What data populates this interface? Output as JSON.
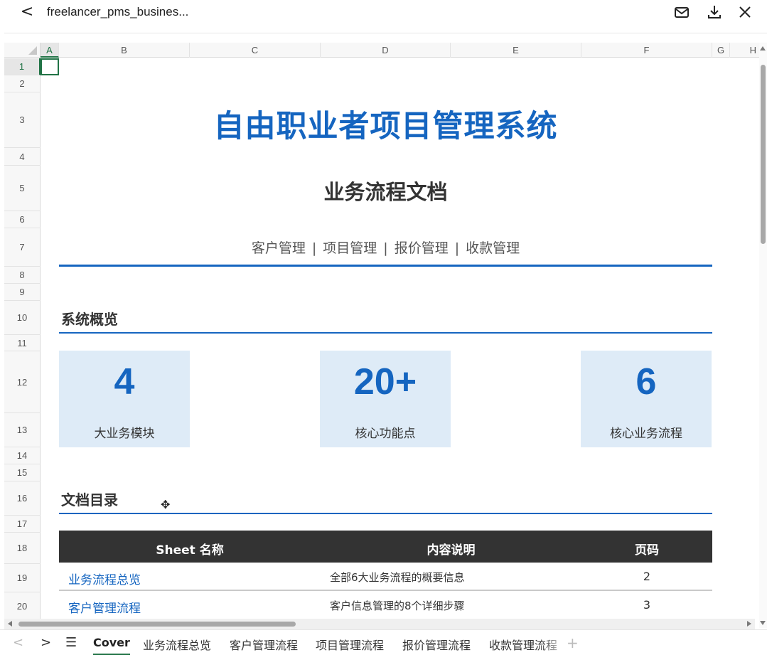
{
  "app": {
    "file_title": "freelancer_pms_busines...",
    "back_glyph": "<",
    "actions": [
      {
        "name": "mail-icon"
      },
      {
        "name": "download-icon"
      },
      {
        "name": "close-icon"
      }
    ]
  },
  "grid": {
    "columns": [
      "A",
      "B",
      "C",
      "D",
      "E",
      "F",
      "G",
      "H"
    ],
    "selected_column": "A",
    "rows": [
      "1",
      "2",
      "3",
      "4",
      "5",
      "6",
      "7",
      "8",
      "9",
      "10",
      "11",
      "12",
      "13",
      "14",
      "15",
      "16",
      "17",
      "18",
      "19",
      "20"
    ],
    "selected_row": "1"
  },
  "cover": {
    "title": "自由职业者项目管理系统",
    "subtitle": "业务流程文档",
    "modules": [
      "客户管理",
      "项目管理",
      "报价管理",
      "收款管理"
    ],
    "module_separator": "|",
    "overview_title": "系统概览",
    "stats": [
      {
        "value": "4",
        "label": "大业务模块"
      },
      {
        "value": "20+",
        "label": "核心功能点"
      },
      {
        "value": "6",
        "label": "核心业务流程"
      }
    ],
    "toc_title": "文档目录",
    "toc_headers": {
      "sheet": "Sheet 名称",
      "desc": "内容说明",
      "page": "页码"
    },
    "toc_rows": [
      {
        "sheet": "业务流程总览",
        "desc": "全部6大业务流程的概要信息",
        "page": "2"
      },
      {
        "sheet": "客户管理流程",
        "desc": "客户信息管理的8个详细步骤",
        "page": "3"
      }
    ]
  },
  "tabs": {
    "prev_glyph": "<",
    "next_glyph": ">",
    "menu_glyph": "☰",
    "items": [
      "Cover",
      "业务流程总览",
      "客户管理流程",
      "项目管理流程",
      "报价管理流程",
      "收款管理流程"
    ],
    "active": "Cover",
    "add_glyph": "+"
  },
  "colors": {
    "accent_blue": "#1565c0",
    "stat_bg": "#deebf7",
    "table_header_bg": "#333333",
    "excel_green": "#217346"
  }
}
